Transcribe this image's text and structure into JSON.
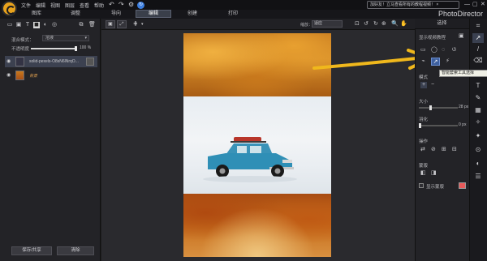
{
  "menu": [
    "文件",
    "编辑",
    "视图",
    "图层",
    "查看",
    "帮助"
  ],
  "toolbar_icons": [
    "undo-icon",
    "redo-icon",
    "settings-icon",
    "sync-icon"
  ],
  "notice_text": "加好友！立马查看所有的教程视频！ ×",
  "brand": "PhotoDirector",
  "mode_tabs": [
    "图库",
    "调整",
    "导向",
    "编辑",
    "创建",
    "打印"
  ],
  "active_mode": "编辑",
  "layers_panel": {
    "blend_label": "混合模式：",
    "blend_value": "溶液",
    "opacity_label": "不透明度",
    "opacity_value": "100 %",
    "opacity_fraction": 1.0,
    "layers": [
      {
        "name": "solid-pexels-O8sN6lNrqO...",
        "selected": true
      },
      {
        "name": "背景",
        "selected": false
      }
    ],
    "save_button": "保存/共享",
    "clear_button": "清除"
  },
  "canvas": {
    "zoom_label": "缩放：",
    "zoom_value": "适应"
  },
  "right_panel": {
    "header": "选择",
    "section1_label": "显示视频教程",
    "tooltip": "智能套索工具选择",
    "mode_label": "模式",
    "size_label": "大小",
    "size_value": "28 px",
    "size_fraction": 0.28,
    "feather_label": "羽化",
    "feather_value": "0 px",
    "feather_fraction": 0.0,
    "action_label": "操作",
    "mask_label": "蒙版",
    "show_mask_label": "显示蒙版",
    "mask_color": "#e85a5a"
  },
  "colors": {
    "accent": "#3d5f9e",
    "arrow": "#f0b81c",
    "logo": "#e8a21c"
  }
}
